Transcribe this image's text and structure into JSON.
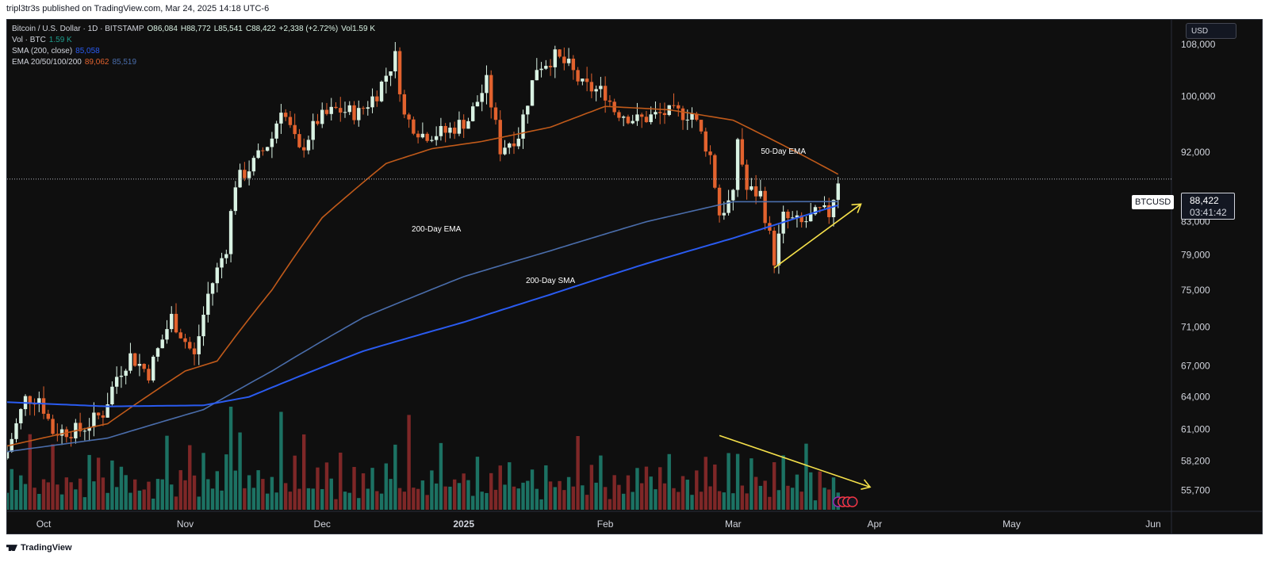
{
  "header": {
    "publisher_line": "tripl3tr3s published on TradingView.com, Mar 24, 2025 14:18 UTC-6"
  },
  "footer": {
    "brand": "TradingView"
  },
  "colors": {
    "background": "#0f0f0f",
    "up": "#d9f2e3",
    "down": "#e2622e",
    "ema50": "#c05a1a",
    "ema200": "#4a6dab",
    "sma200": "#2a5bf0",
    "annotation": "#f5e04a",
    "vol_up": "#1e7d6d",
    "vol_down": "#8b2a2a"
  },
  "legend": {
    "l1_symbol": "Bitcoin / U.S. Dollar · 1D · BITSTAMP",
    "l1_o": "O86,084",
    "l1_h": "H88,772",
    "l1_l": "L85,541",
    "l1_c": "C88,422",
    "l1_chg": "+2,338 (+2.72%)",
    "l1_vol": "Vol1.59 K",
    "l2_name": "Vol · BTC",
    "l2_val": "1.59 K",
    "l3_name": "SMA (200, close)",
    "l3_val": "85,058",
    "l4_name": "EMA 20/50/100/200",
    "l4_v1": "89,062",
    "l4_v2": "85,519"
  },
  "price_scale": {
    "currency": "USD",
    "symbol": "BTCUSD",
    "last_price": "88,422",
    "countdown": "03:41:42"
  },
  "chart_data": {
    "type": "candlestick",
    "title": "Bitcoin / U.S. Dollar · 1D · BITSTAMP",
    "y_scale": "log",
    "ylim": [
      54000,
      112000
    ],
    "y_ticks": [
      "108,000",
      "100,000",
      "92,000",
      "83,000",
      "79,000",
      "75,000",
      "71,000",
      "67,000",
      "64,000",
      "61,000",
      "58,200",
      "55,700"
    ],
    "y_tick_values": [
      108000,
      100000,
      92000,
      83000,
      79000,
      75000,
      71000,
      67000,
      64000,
      61000,
      58200,
      55700
    ],
    "x_range": [
      "2024-09-23",
      "2025-06-05"
    ],
    "x_ticks": [
      {
        "label": "Oct",
        "date": "2024-10-01"
      },
      {
        "label": "Nov",
        "date": "2024-11-01"
      },
      {
        "label": "Dec",
        "date": "2024-12-01"
      },
      {
        "label": "2025",
        "date": "2025-01-01"
      },
      {
        "label": "Feb",
        "date": "2025-02-01"
      },
      {
        "label": "Mar",
        "date": "2025-03-01"
      },
      {
        "label": "Apr",
        "date": "2025-04-01"
      },
      {
        "label": "May",
        "date": "2025-05-01"
      },
      {
        "label": "Jun",
        "date": "2025-06-01"
      }
    ],
    "close_points": [
      [
        "2024-09-23",
        59000
      ],
      [
        "2024-09-27",
        63800
      ],
      [
        "2024-09-30",
        64000
      ],
      [
        "2024-10-03",
        60800
      ],
      [
        "2024-10-09",
        60900
      ],
      [
        "2024-10-14",
        62500
      ],
      [
        "2024-10-17",
        66000
      ],
      [
        "2024-10-20",
        68000
      ],
      [
        "2024-10-24",
        66300
      ],
      [
        "2024-10-29",
        72000
      ],
      [
        "2024-11-03",
        67900
      ],
      [
        "2024-11-06",
        74500
      ],
      [
        "2024-11-10",
        80000
      ],
      [
        "2024-11-12",
        88000
      ],
      [
        "2024-11-16",
        90500
      ],
      [
        "2024-11-20",
        94000
      ],
      [
        "2024-11-22",
        98500
      ],
      [
        "2024-11-26",
        92000
      ],
      [
        "2024-11-30",
        96500
      ],
      [
        "2024-12-04",
        98000
      ],
      [
        "2024-12-09",
        97500
      ],
      [
        "2024-12-13",
        100500
      ],
      [
        "2024-12-17",
        106000
      ],
      [
        "2024-12-19",
        97000
      ],
      [
        "2024-12-23",
        94500
      ],
      [
        "2024-12-28",
        94800
      ],
      [
        "2025-01-02",
        96600
      ],
      [
        "2025-01-06",
        102000
      ],
      [
        "2025-01-09",
        92500
      ],
      [
        "2025-01-13",
        94500
      ],
      [
        "2025-01-17",
        104500
      ],
      [
        "2025-01-21",
        106000
      ],
      [
        "2025-01-24",
        104500
      ],
      [
        "2025-01-27",
        101500
      ],
      [
        "2025-02-01",
        100500
      ],
      [
        "2025-02-03",
        98000
      ],
      [
        "2025-02-08",
        96500
      ],
      [
        "2025-02-14",
        97500
      ],
      [
        "2025-02-20",
        97500
      ],
      [
        "2025-02-24",
        91500
      ],
      [
        "2025-02-26",
        84000
      ],
      [
        "2025-03-01",
        86000
      ],
      [
        "2025-03-02",
        94000
      ],
      [
        "2025-03-04",
        87000
      ],
      [
        "2025-03-07",
        86500
      ],
      [
        "2025-03-10",
        78500
      ],
      [
        "2025-03-12",
        83500
      ],
      [
        "2025-03-16",
        82700
      ],
      [
        "2025-03-20",
        84200
      ],
      [
        "2025-03-22",
        84000
      ],
      [
        "2025-03-24",
        88422
      ]
    ],
    "series": [
      {
        "name": "50-Day EMA",
        "points": [
          [
            "2024-09-23",
            59500
          ],
          [
            "2024-10-15",
            61500
          ],
          [
            "2024-11-01",
            66500
          ],
          [
            "2024-11-08",
            67500
          ],
          [
            "2024-11-20",
            75000
          ],
          [
            "2024-12-01",
            83500
          ],
          [
            "2024-12-15",
            90500
          ],
          [
            "2024-12-25",
            92500
          ],
          [
            "2025-01-05",
            93500
          ],
          [
            "2025-01-20",
            95500
          ],
          [
            "2025-02-01",
            98500
          ],
          [
            "2025-02-15",
            98000
          ],
          [
            "2025-03-01",
            96500
          ],
          [
            "2025-03-15",
            92000
          ],
          [
            "2025-03-24",
            89062
          ]
        ]
      },
      {
        "name": "200-Day EMA",
        "points": [
          [
            "2024-09-23",
            59000
          ],
          [
            "2024-10-15",
            60200
          ],
          [
            "2024-11-05",
            62800
          ],
          [
            "2024-11-20",
            66500
          ],
          [
            "2024-12-10",
            72000
          ],
          [
            "2025-01-01",
            76500
          ],
          [
            "2025-01-20",
            79500
          ],
          [
            "2025-02-10",
            83000
          ],
          [
            "2025-03-01",
            85500
          ],
          [
            "2025-03-24",
            85519
          ]
        ]
      },
      {
        "name": "200-Day SMA",
        "points": [
          [
            "2024-09-23",
            63500
          ],
          [
            "2024-10-15",
            63100
          ],
          [
            "2024-11-05",
            63200
          ],
          [
            "2024-11-15",
            64000
          ],
          [
            "2024-12-10",
            68500
          ],
          [
            "2025-01-01",
            71500
          ],
          [
            "2025-01-20",
            74500
          ],
          [
            "2025-02-10",
            78000
          ],
          [
            "2025-03-01",
            81000
          ],
          [
            "2025-03-24",
            85058
          ]
        ]
      }
    ],
    "volume": {
      "pattern": [
        0.22,
        0.35,
        0.18,
        0.45,
        0.28,
        0.62,
        0.3,
        0.2,
        0.4,
        0.25,
        0.55,
        0.33,
        0.15,
        0.48,
        0.27
      ],
      "spikes": [
        [
          "2024-11-11",
          1.0
        ],
        [
          "2024-11-22",
          0.95
        ],
        [
          "2024-12-20",
          0.92
        ],
        [
          "2024-11-13",
          0.75
        ],
        [
          "2025-02-28",
          0.55
        ]
      ]
    },
    "annotations": [
      {
        "text": "50-Day EMA",
        "date": "2025-03-12",
        "price": 91800
      },
      {
        "text": "200-Day EMA",
        "date": "2024-12-26",
        "price": 81800
      },
      {
        "text": "200-Day SMA",
        "date": "2025-01-20",
        "price": 75800
      }
    ],
    "trend_arrows": [
      {
        "from": [
          "2025-03-10",
          77500
        ],
        "to": [
          "2025-03-29",
          85200
        ]
      },
      {
        "from_vol": [
          "2025-02-26",
          0.72
        ],
        "to_vol": [
          "2025-03-31",
          0.22
        ]
      }
    ],
    "current_price": 88422
  }
}
